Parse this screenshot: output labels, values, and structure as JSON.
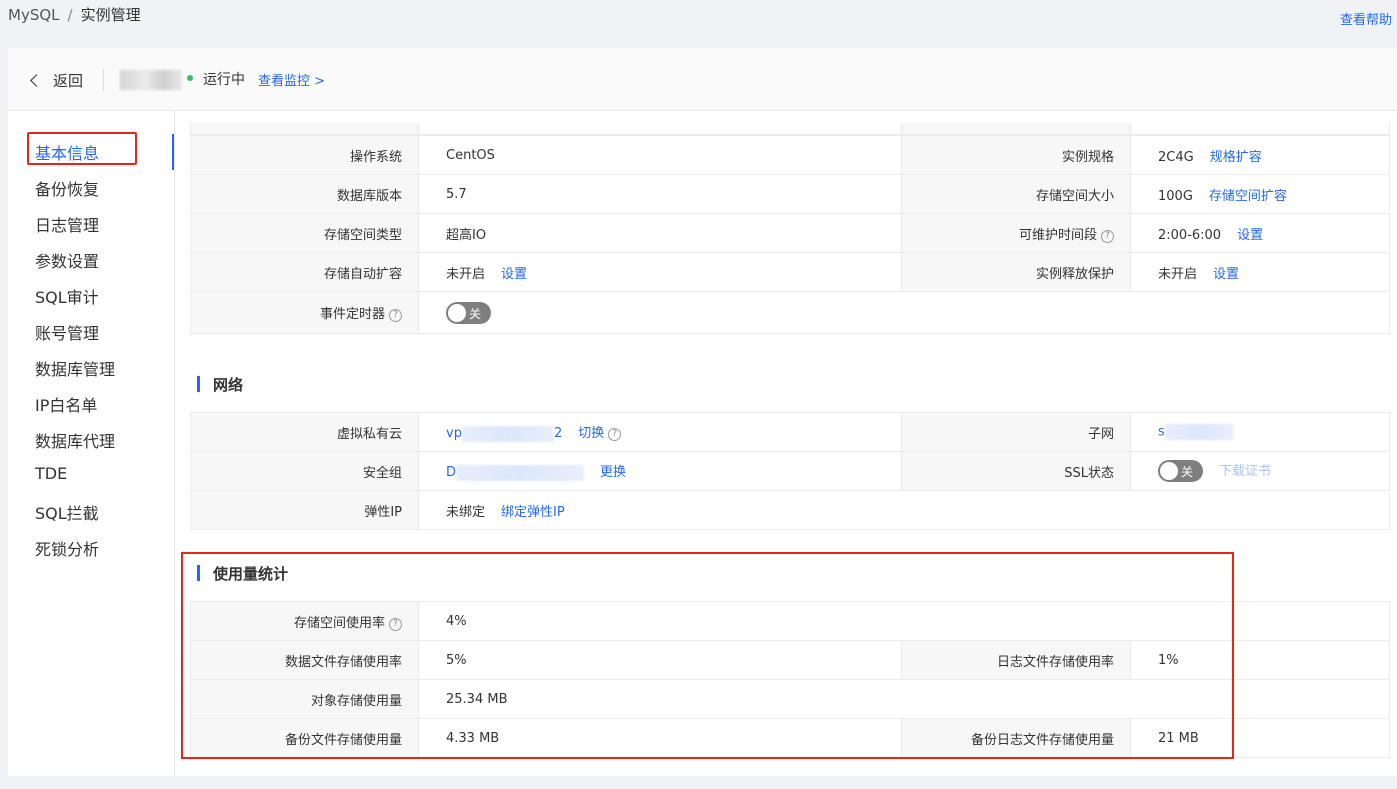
{
  "breadcrumb": {
    "root": "MySQL",
    "separator": "/",
    "current": "实例管理"
  },
  "help_link": "查看帮助",
  "header": {
    "back_label": "返回",
    "status": "运行中",
    "monitor_link": "查看监控 >"
  },
  "sidebar": {
    "items": [
      {
        "label": "基本信息",
        "active": true
      },
      {
        "label": "备份恢复"
      },
      {
        "label": "日志管理"
      },
      {
        "label": "参数设置"
      },
      {
        "label": "SQL审计"
      },
      {
        "label": "账号管理"
      },
      {
        "label": "数据库管理"
      },
      {
        "label": "IP白名单"
      },
      {
        "label": "数据库代理"
      },
      {
        "label": "TDE"
      },
      {
        "label": "SQL拦截"
      },
      {
        "label": "死锁分析"
      }
    ]
  },
  "basic": {
    "os_label": "操作系统",
    "os_value": "CentOS",
    "spec_label": "实例规格",
    "spec_value": "2C4G",
    "spec_link": "规格扩容",
    "db_version_label": "数据库版本",
    "db_version_value": "5.7",
    "storage_size_label": "存储空间大小",
    "storage_size_value": "100G",
    "storage_size_link": "存储空间扩容",
    "storage_type_label": "存储空间类型",
    "storage_type_value": "超高IO",
    "maint_label": "可维护时间段",
    "maint_value": "2:00-6:00",
    "maint_link": "设置",
    "auto_expand_label": "存储自动扩容",
    "auto_expand_value": "未开启",
    "auto_expand_link": "设置",
    "release_protect_label": "实例释放保护",
    "release_protect_value": "未开启",
    "release_protect_link": "设置",
    "event_scheduler_label": "事件定时器",
    "event_scheduler_toggle": "关"
  },
  "network": {
    "title": "网络",
    "vpc_label": "虚拟私有云",
    "vpc_prefix": "vp",
    "vpc_suffix": "2",
    "vpc_link": "切换",
    "subnet_label": "子网",
    "subnet_prefix": "s",
    "sg_label": "安全组",
    "sg_prefix": "D",
    "sg_link": "更换",
    "ssl_label": "SSL状态",
    "ssl_toggle": "关",
    "ssl_link": "下载证书",
    "eip_label": "弹性IP",
    "eip_value": "未绑定",
    "eip_link": "绑定弹性IP"
  },
  "usage": {
    "title": "使用量统计",
    "storage_rate_label": "存储空间使用率",
    "storage_rate_value": "4%",
    "data_file_label": "数据文件存储使用率",
    "data_file_value": "5%",
    "log_file_label": "日志文件存储使用率",
    "log_file_value": "1%",
    "object_storage_label": "对象存储使用量",
    "object_storage_value": "25.34 MB",
    "backup_file_label": "备份文件存储使用量",
    "backup_file_value": "4.33 MB",
    "backup_log_label": "备份日志文件存储使用量",
    "backup_log_value": "21 MB"
  },
  "colors": {
    "accent": "#2468f2",
    "highlight": "#e8231a",
    "status_running": "#34c26a"
  }
}
